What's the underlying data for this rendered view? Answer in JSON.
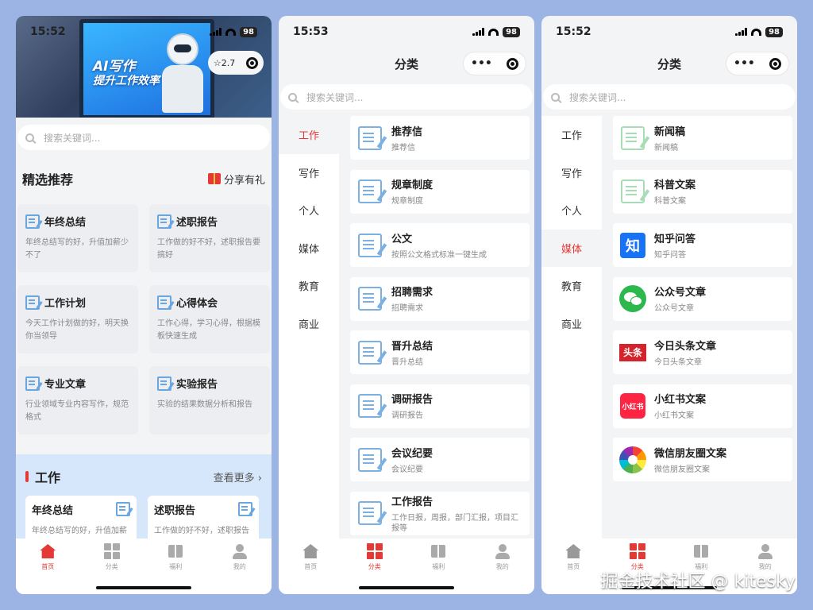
{
  "status": {
    "time1": "15:52",
    "time2": "15:53",
    "time3": "15:52",
    "battery": "98"
  },
  "p1": {
    "banner_line1": "AI写作",
    "banner_line2": "提升工作效率",
    "rating": "☆2.7",
    "search_placeholder": "搜索关键词...",
    "section_title": "精选推荐",
    "share_label": "分享有礼",
    "cards": [
      {
        "title": "年终总结",
        "desc": "年终总结写的好，升值加薪少不了"
      },
      {
        "title": "述职报告",
        "desc": "工作做的好不好，述职报告要搞好"
      },
      {
        "title": "工作计划",
        "desc": "今天工作计划做的好，明天换你当领导"
      },
      {
        "title": "心得体会",
        "desc": "工作心得，学习心得，根据模板快速生成"
      },
      {
        "title": "专业文章",
        "desc": "行业领域专业内容写作，规范格式"
      },
      {
        "title": "实验报告",
        "desc": "实验的结果数据分析和报告"
      }
    ],
    "work_title": "工作",
    "work_more": "查看更多 ›",
    "work_cards": [
      {
        "title": "年终总结",
        "desc": "年终总结写的好，升值加薪"
      },
      {
        "title": "述职报告",
        "desc": "工作做的好不好，述职报告"
      }
    ]
  },
  "category": {
    "title": "分类",
    "search_placeholder": "搜索关键词...",
    "menu": [
      "工作",
      "写作",
      "个人",
      "媒体",
      "教育",
      "商业"
    ],
    "work_items": [
      {
        "title": "推荐信",
        "desc": "推荐信"
      },
      {
        "title": "规章制度",
        "desc": "规章制度"
      },
      {
        "title": "公文",
        "desc": "按照公文格式标准一键生成"
      },
      {
        "title": "招聘需求",
        "desc": "招聘需求"
      },
      {
        "title": "晋升总结",
        "desc": "晋升总结"
      },
      {
        "title": "调研报告",
        "desc": "调研报告"
      },
      {
        "title": "会议纪要",
        "desc": "会议纪要"
      },
      {
        "title": "工作报告",
        "desc": "工作日报，周报，部门汇报，项目汇报等"
      }
    ],
    "media_items": [
      {
        "title": "新闻稿",
        "desc": "新闻稿",
        "icon": "doc"
      },
      {
        "title": "科普文案",
        "desc": "科普文案",
        "icon": "doc"
      },
      {
        "title": "知乎问答",
        "desc": "知乎问答",
        "icon": "zhihu",
        "icon_text": "知"
      },
      {
        "title": "公众号文章",
        "desc": "公众号文章",
        "icon": "wechat"
      },
      {
        "title": "今日头条文章",
        "desc": "今日头条文章",
        "icon": "toutiao",
        "icon_text": "头条"
      },
      {
        "title": "小红书文案",
        "desc": "小红书文案",
        "icon": "xiaohongshu",
        "icon_text": "小红书"
      },
      {
        "title": "微信朋友圈文案",
        "desc": "微信朋友圈文案",
        "icon": "moments"
      }
    ]
  },
  "tabbar": [
    "首页",
    "分类",
    "福利",
    "我的"
  ],
  "watermark": "掘金技术社区 @ kitesky",
  "colors": {
    "accent": "#e53935",
    "page_bg": "#9bb4e4"
  }
}
